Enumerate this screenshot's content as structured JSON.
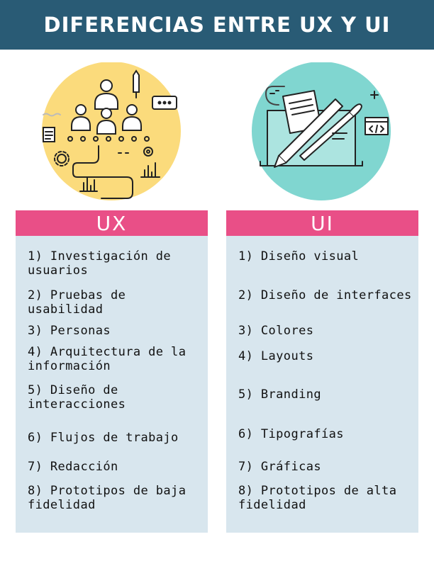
{
  "header": {
    "title": "DIFERENCIAS ENTRE UX Y UI"
  },
  "ux": {
    "label": "UX",
    "items": [
      "1) Investigación de usuarios",
      "2) Pruebas de usabilidad",
      "3) Personas",
      "4) Arquitectura de la información",
      "5) Diseño de interacciones",
      "6) Flujos de trabajo",
      "7) Redacción",
      "8) Prototipos de baja fidelidad"
    ]
  },
  "ui": {
    "label": "UI",
    "items": [
      "1) Diseño visual",
      "2) Diseño de interfaces",
      "3) Colores",
      "4) Layouts",
      "5) Branding",
      "6) Tipografías",
      "7) Gráficas",
      "8) Prototipos de alta fidelidad"
    ]
  },
  "colors": {
    "header": "#295b75",
    "accent": "#e94f87",
    "panel": "#d8e6ee",
    "ux_circle": "#fbdb7c",
    "ui_circle": "#80d6d0"
  },
  "icons": {
    "ux": "team-research-illustration",
    "ui": "design-tools-illustration"
  }
}
